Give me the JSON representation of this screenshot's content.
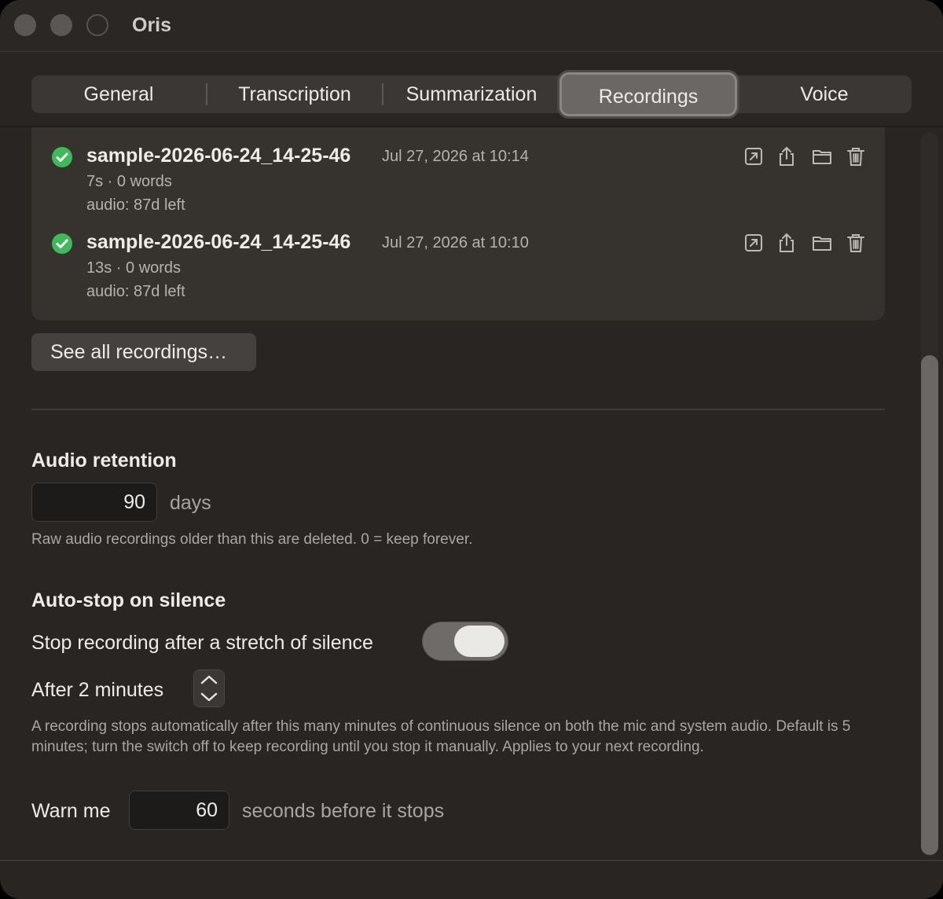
{
  "window": {
    "title": "Oris"
  },
  "tabs": [
    {
      "label": "General",
      "active": false
    },
    {
      "label": "Transcription",
      "active": false
    },
    {
      "label": "Summarization",
      "active": false
    },
    {
      "label": "Recordings",
      "active": true
    },
    {
      "label": "Voice",
      "active": false
    }
  ],
  "recordings": [
    {
      "name": "sample-2026-06-24_14-25-46",
      "date": "Jul 27, 2026 at 10:14",
      "meta": "7s · 0 words",
      "audio": "audio: 87d left",
      "status": "complete"
    },
    {
      "name": "sample-2026-06-24_14-25-46",
      "date": "Jul 27, 2026 at 10:10",
      "meta": "13s · 0 words",
      "audio": "audio: 87d left",
      "status": "complete"
    }
  ],
  "row_icons": [
    "open-icon",
    "share-icon",
    "folder-icon",
    "trash-icon"
  ],
  "see_all_label": "See all recordings…",
  "retention": {
    "title": "Audio retention",
    "value": "90",
    "unit": "days",
    "help": "Raw audio recordings older than this are deleted. 0 = keep forever."
  },
  "autostop": {
    "title": "Auto-stop on silence",
    "toggle_label": "Stop recording after a stretch of silence",
    "toggle_on": true,
    "after_label": "After 2 minutes",
    "help": "A recording stops automatically after this many minutes of continuous silence on both the mic and system audio. Default is 5 minutes; turn the switch off to keep recording until you stop it manually. Applies to your next recording.",
    "warn_label": "Warn me",
    "warn_value": "60",
    "warn_unit": "seconds before it stops"
  },
  "colors": {
    "accent_green": "#3dba5a",
    "window_bg": "#282522",
    "card_bg": "#36332f"
  }
}
